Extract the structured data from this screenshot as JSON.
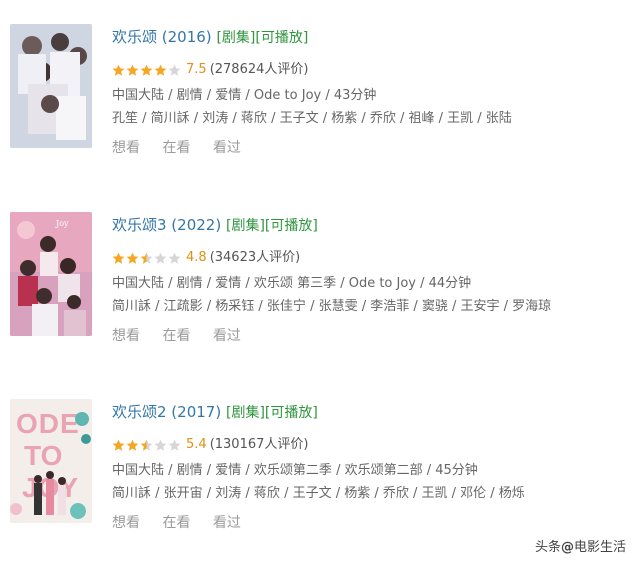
{
  "colors": {
    "link": "#3377aa",
    "tag": "#2e963d",
    "star": "#f5a623",
    "star_empty": "#d6d6d6",
    "score": "#e09015"
  },
  "items": [
    {
      "title": "欢乐颂 (2016)",
      "tag_series": "[剧集]",
      "tag_playable": "[可播放]",
      "rating_stars": 4,
      "score": "7.5",
      "votes": "(278624人评价)",
      "meta": "中国大陆 / 剧情 / 爱情 / Ode to Joy / 43分钟",
      "cast": "孔笙 / 简川訸 / 刘涛 / 蒋欣 / 王子文 / 杨紫 / 乔欣 / 祖峰 / 王凯 / 张陆",
      "action_want": "想看",
      "action_watching": "在看",
      "action_watched": "看过"
    },
    {
      "title": "欢乐颂3 (2022)",
      "tag_series": "[剧集]",
      "tag_playable": "[可播放]",
      "rating_stars": 2.5,
      "score": "4.8",
      "votes": "(34623人评价)",
      "meta": "中国大陆 / 剧情 / 爱情 / 欢乐颂 第三季 / Ode to Joy / 44分钟",
      "cast": "简川訸 / 江疏影 / 杨采钰 / 张佳宁 / 张慧雯 / 李浩菲 / 窦骁 / 王安宇 / 罗海琼",
      "action_want": "想看",
      "action_watching": "在看",
      "action_watched": "看过"
    },
    {
      "title": "欢乐颂2 (2017)",
      "tag_series": "[剧集]",
      "tag_playable": "[可播放]",
      "rating_stars": 2.5,
      "score": "5.4",
      "votes": "(130167人评价)",
      "meta": "中国大陆 / 剧情 / 爱情 / 欢乐颂第二季 / 欢乐颂第二部 / 45分钟",
      "cast": "简川訸 / 张开宙 / 刘涛 / 蒋欣 / 王子文 / 杨紫 / 乔欣 / 王凯 / 邓伦 / 杨烁",
      "action_want": "想看",
      "action_watching": "在看",
      "action_watched": "看过"
    }
  ],
  "poster3_text": "ODE TO JOY",
  "watermark": {
    "prefix": "头条",
    "at": "@",
    "name": "电影生活"
  }
}
